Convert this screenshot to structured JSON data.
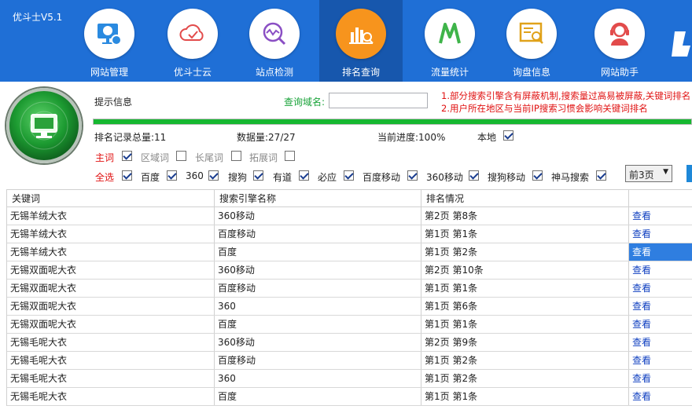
{
  "app": {
    "title": "优斗士V5.1"
  },
  "nav": [
    {
      "label": "网站管理",
      "icon": "website-manage-icon"
    },
    {
      "label": "优斗士云",
      "icon": "cloud-icon"
    },
    {
      "label": "站点检测",
      "icon": "site-check-icon"
    },
    {
      "label": "排名查询",
      "icon": "rank-query-icon",
      "active": true
    },
    {
      "label": "流量统计",
      "icon": "traffic-stats-icon"
    },
    {
      "label": "询盘信息",
      "icon": "inquiry-info-icon"
    },
    {
      "label": "网站助手",
      "icon": "assistant-icon"
    }
  ],
  "panel": {
    "hint_label": "提示信息",
    "domain_label": "查询域名:",
    "domain_value": "",
    "notice_line1": "1.部分搜索引擎含有屏蔽机制,搜索量过高易被屏蔽,关键词排名",
    "notice_line2": "2.用户所在地区与当前IP搜索习惯会影响关键词排名",
    "progress_percent": 100
  },
  "stats": {
    "total": "排名记录总量:11",
    "count": "数据量:27/27",
    "progress": "当前进度:100%",
    "local_label": "本地"
  },
  "word_types": {
    "main": "主词",
    "region": "区域词",
    "long_tail": "长尾词",
    "expand": "拓展词"
  },
  "engines": {
    "all": "全选",
    "items": [
      "百度",
      "360",
      "搜狗",
      "有道",
      "必应",
      "百度移动",
      "360移动",
      "搜狗移动",
      "神马搜索"
    ]
  },
  "pages_select": {
    "value": "前3页",
    "arrow": "▼"
  },
  "table": {
    "headers": [
      "关键词",
      "搜索引擎名称",
      "排名情况",
      ""
    ],
    "rows": [
      {
        "keyword": "无锡羊绒大衣",
        "engine": "360移动",
        "rank": "第2页 第8条",
        "action": "查看"
      },
      {
        "keyword": "无锡羊绒大衣",
        "engine": "百度移动",
        "rank": "第1页 第1条",
        "action": "查看"
      },
      {
        "keyword": "无锡羊绒大衣",
        "engine": "百度",
        "rank": "第1页 第2条",
        "action": "查看",
        "selected": true
      },
      {
        "keyword": "无锡双面呢大衣",
        "engine": "360移动",
        "rank": "第2页 第10条",
        "action": "查看"
      },
      {
        "keyword": "无锡双面呢大衣",
        "engine": "百度移动",
        "rank": "第1页 第1条",
        "action": "查看"
      },
      {
        "keyword": "无锡双面呢大衣",
        "engine": "360",
        "rank": "第1页 第6条",
        "action": "查看"
      },
      {
        "keyword": "无锡双面呢大衣",
        "engine": "百度",
        "rank": "第1页 第1条",
        "action": "查看"
      },
      {
        "keyword": "无锡毛呢大衣",
        "engine": "360移动",
        "rank": "第2页 第9条",
        "action": "查看"
      },
      {
        "keyword": "无锡毛呢大衣",
        "engine": "百度移动",
        "rank": "第1页 第2条",
        "action": "查看"
      },
      {
        "keyword": "无锡毛呢大衣",
        "engine": "360",
        "rank": "第1页 第2条",
        "action": "查看"
      },
      {
        "keyword": "无锡毛呢大衣",
        "engine": "百度",
        "rank": "第1页 第1条",
        "action": "查看"
      }
    ]
  },
  "colors": {
    "header_blue": "#1f6fd6",
    "active_tab": "#1757ad",
    "active_circle": "#f7941d",
    "notice_red": "#e01010",
    "progress_green": "#16b830"
  }
}
